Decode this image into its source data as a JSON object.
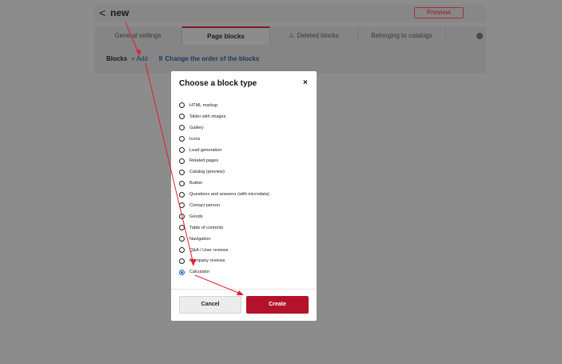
{
  "header": {
    "back_label": "<",
    "page_name": "new",
    "preview_label": "Preview"
  },
  "tabs": [
    {
      "label": "General settings",
      "active": false
    },
    {
      "label": "Page blocks",
      "active": true
    },
    {
      "label": "Deleted blocks",
      "active": false,
      "icon": "warning-icon"
    },
    {
      "label": "Belonging to catalogs",
      "active": false
    },
    {
      "label": "",
      "active": false,
      "icon": "info-icon"
    }
  ],
  "blocks_bar": {
    "label": "Blocks",
    "add_label": "+ Add",
    "order_label": "⠿ Change the order of the blocks"
  },
  "modal": {
    "title": "Choose a block type",
    "close_label": "×",
    "options": [
      {
        "label": "HTML markup",
        "checked": false
      },
      {
        "label": "Slider with images",
        "checked": false
      },
      {
        "label": "Gallery",
        "checked": false
      },
      {
        "label": "Icons",
        "checked": false
      },
      {
        "label": "Lead generation",
        "checked": false
      },
      {
        "label": "Related pages",
        "checked": false
      },
      {
        "label": "Catalog (preview)",
        "checked": false
      },
      {
        "label": "Button",
        "checked": false
      },
      {
        "label": "Questions and answers (with microdata)",
        "checked": false
      },
      {
        "label": "Contact person",
        "checked": false
      },
      {
        "label": "Goods",
        "checked": false
      },
      {
        "label": "Table of contents",
        "checked": false
      },
      {
        "label": "Navigation",
        "checked": false
      },
      {
        "label": "Q&A / User reviews",
        "checked": false
      },
      {
        "label": "Company reviews",
        "checked": false
      },
      {
        "label": "Calculator",
        "checked": true
      }
    ],
    "cancel_label": "Cancel",
    "create_label": "Create"
  },
  "colors": {
    "accent": "#b3122a",
    "annotation": "#e0203a",
    "radio_selected": "#1a5fc7"
  }
}
